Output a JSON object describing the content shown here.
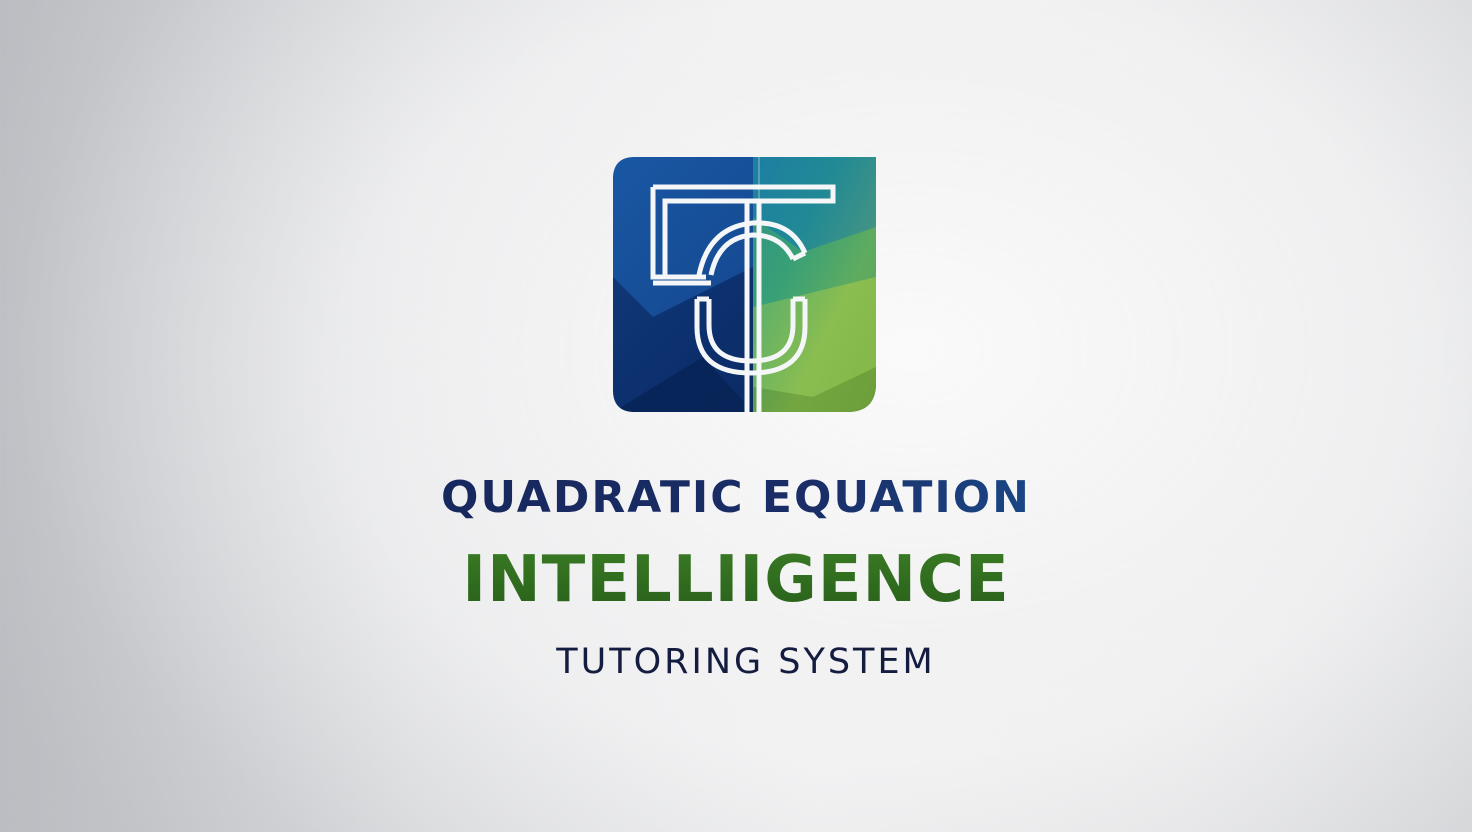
{
  "logo": {
    "icon": "tc-monogram-icon",
    "colors": {
      "navy": "#0d2a66",
      "blue": "#1d57a3",
      "teal": "#1f8e8a",
      "green": "#7fb443",
      "light_green": "#a8c95a"
    }
  },
  "title": {
    "line1": "QUADRATIC EQUATION",
    "line2": "INTELLIIGENCE",
    "line3": "TUTORING SYSTEM"
  },
  "colors": {
    "line1": "#15245a",
    "line1_accent": "#2a86c9",
    "line2": "#2f6a1f",
    "line3": "#141d3f",
    "background": "#f0f0f1"
  }
}
